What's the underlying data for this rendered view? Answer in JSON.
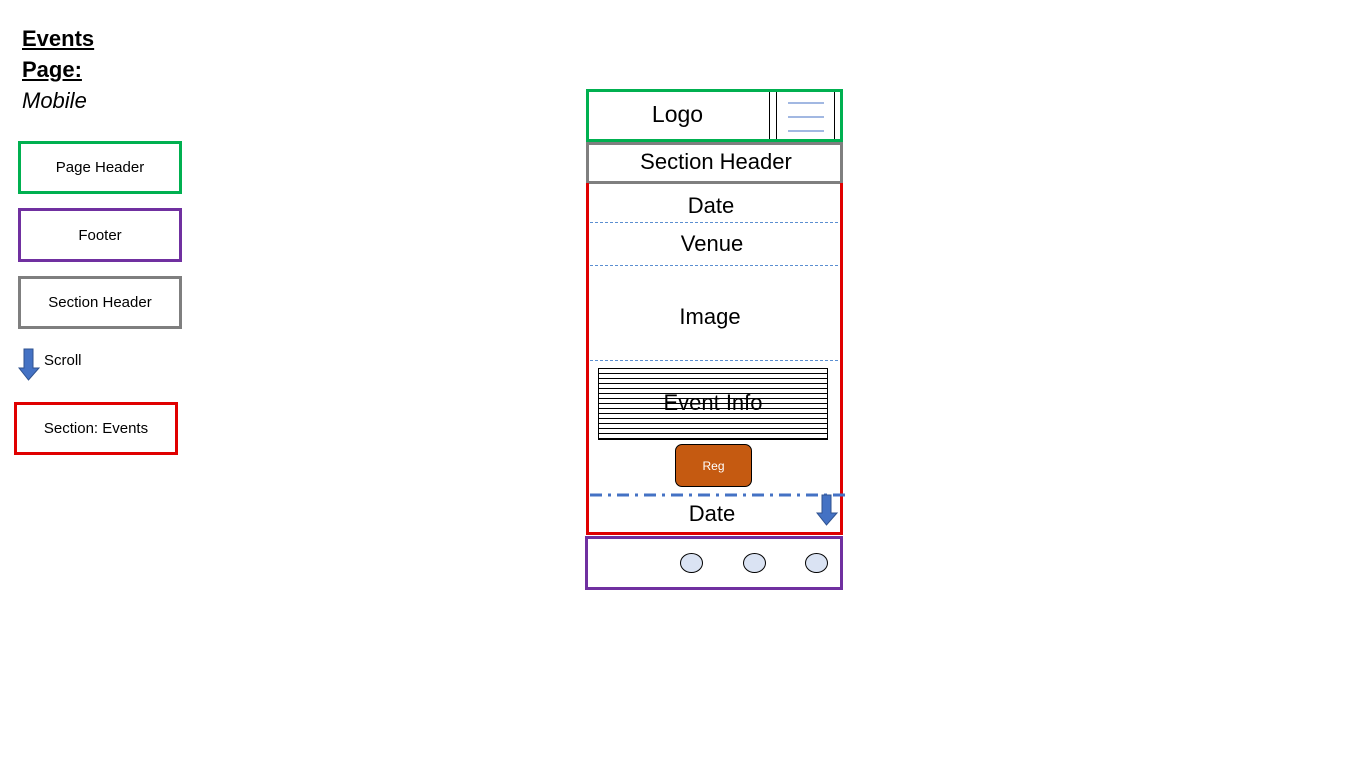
{
  "title": {
    "line1": "Events",
    "line2": "Page:",
    "line3": "Mobile"
  },
  "legend": {
    "page_header": "Page Header",
    "footer": "Footer",
    "section_header": "Section Header",
    "scroll": "Scroll",
    "section_events": "Section: Events"
  },
  "wireframe": {
    "logo": "Logo",
    "section_header": "Section Header",
    "date": "Date",
    "venue": "Venue",
    "image": "Image",
    "event_info": "Event Info",
    "reg_button": "Reg",
    "date_next": "Date"
  },
  "colors": {
    "page_header": "#00b050",
    "footer": "#7030a0",
    "section_header": "#7f7f7f",
    "section_events": "#e00000",
    "scroll_arrow": "#4472c4",
    "reg_button": "#c55a11",
    "footer_dot": "#dae3f3"
  }
}
